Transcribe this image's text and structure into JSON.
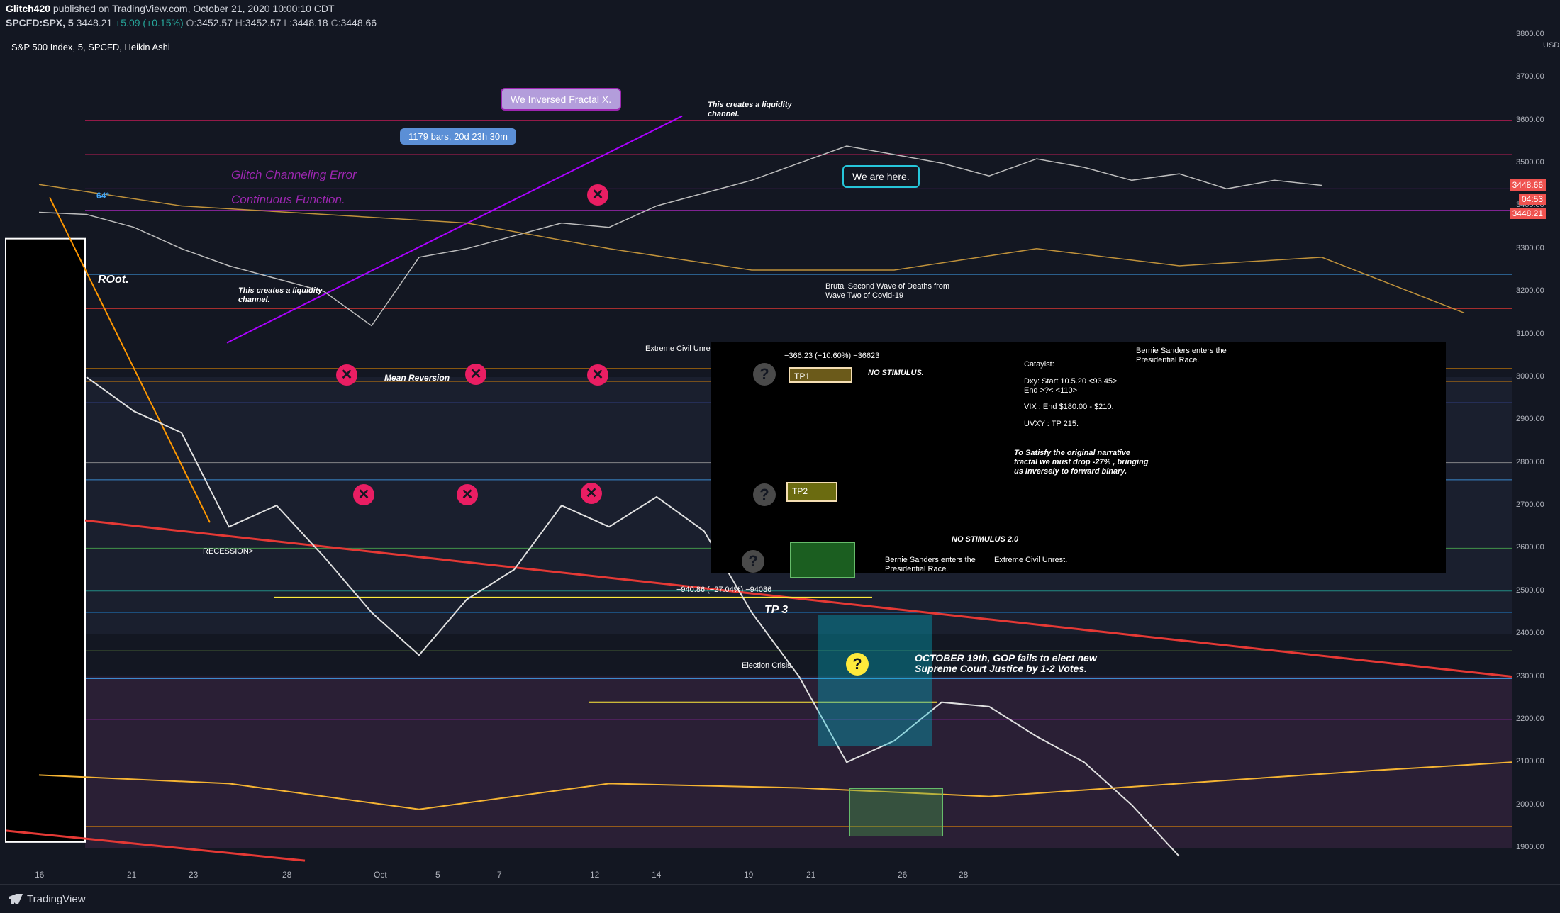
{
  "header": {
    "publisher": "Glitch420",
    "published_text": "published on TradingView.com, October 21, 2020 10:00:10 CDT",
    "symbol": "SPCFD:SPX, 5",
    "last": "3448.21",
    "change": "+5.09 (+0.15%)",
    "o_label": "O:",
    "o_value": "3452.57",
    "h_label": "H:",
    "h_value": "3452.57",
    "l_label": "L:",
    "l_value": "3448.18",
    "c_label": "C:",
    "c_value": "3448.66",
    "legend": "S&P 500 Index, 5, SPCFD, Heikin Ashi"
  },
  "footer": {
    "brand": "TradingView"
  },
  "price_axis": {
    "currency": "USD",
    "ticks": [
      "3800.00",
      "3700.00",
      "3600.00",
      "3500.00",
      "3400.00",
      "3300.00",
      "3200.00",
      "3100.00",
      "3000.00",
      "2900.00",
      "2800.00",
      "2700.00",
      "2600.00",
      "2500.00",
      "2400.00",
      "2300.00",
      "2200.00",
      "2100.00",
      "2000.00",
      "1900.00"
    ],
    "last_price_1": "3448.66",
    "countdown": "04:53",
    "last_price_2": "3448.21"
  },
  "annotations": {
    "inversed_fractal": "We Inversed Fractal X.",
    "bars_range": "1179 bars, 20d 23h 30m",
    "liquidity_top": "This creates a liquidity channel.",
    "glitch_error": "Glitch Channeling Error",
    "continuous": "Continuous Function.",
    "we_are_here": "We are here.",
    "sixty_four": "64°",
    "root": "ROot.",
    "liquidity_left": "This creates a liquidity channel.",
    "second_wave": "Brutal Second Wave of Deaths from Wave Two of Covid-19",
    "civil_unrest_top": "Extreme Civil Unrest.",
    "mean_reversion": "Mean Reversion",
    "measure_1": "−366.23 (−10.60%) −36623",
    "tp1": "TP1",
    "no_stimulus": "NO STIMULUS.",
    "catalyst_title": "Cataylst:",
    "catalyst_dxy": "Dxy: Start 10.5.20 <93.45>",
    "catalyst_end": "End >?< <110>",
    "catalyst_vix": "VIX : End $180.00 - $210.",
    "catalyst_uvxy": "UVXY : TP 215.",
    "bernie_top": "Bernie Sanders enters the Presidential Race.",
    "satisfy": "To Satisfy the original narrative fractal we must drop -27% , bringing us inversely to forward binary.",
    "tp2": "TP2",
    "no_stimulus_2": "NO STIMULUS 2.0",
    "bernie_bottom": "Bernie Sanders enters the Presidential Race.",
    "civil_unrest_bottom": "Extreme Civil Unrest.",
    "recession": "RECESSION>",
    "measure_2": "−940.86 (−27.04%) −94086",
    "tp3": "TP 3",
    "election_crisis": "Election Crisis",
    "october": "OCTOBER 19th, GOP fails to elect new Supreme Court Justice by 1-2 Votes.",
    "x_symbol": "✕",
    "q_symbol": "?"
  },
  "colors": {
    "background": "#131722",
    "purple": "#9c27b0",
    "magenta": "#e91e63",
    "red_line": "#e53935",
    "orange": "#ff9800",
    "yellow": "#ffeb3b",
    "cyan_box": "#00bcd4",
    "green_box": "#4caf50",
    "price_red": "#ef5350"
  },
  "chart_data": {
    "type": "line",
    "title": "S&P 500 Index, 5, SPCFD, Heikin Ashi",
    "xlabel": "",
    "ylabel": "",
    "x_ticks": [
      "16",
      "21",
      "23",
      "28",
      "Oct",
      "5",
      "7",
      "12",
      "14",
      "19",
      "21",
      "26",
      "28"
    ],
    "ylim": [
      1850,
      3820
    ],
    "grid": false,
    "series": [
      {
        "x": [
          16,
          17,
          18,
          19,
          20,
          21,
          22,
          23,
          24,
          25,
          26,
          27,
          28,
          29,
          30,
          31,
          32,
          33,
          34,
          35,
          36,
          37,
          38,
          39,
          40,
          41,
          42,
          43
        ],
        "values": [
          3385,
          3380,
          3350,
          3300,
          3260,
          3230,
          3200,
          3120,
          3280,
          3300,
          3330,
          3360,
          3350,
          3400,
          3430,
          3460,
          3500,
          3540,
          3520,
          3500,
          3470,
          3510,
          3490,
          3460,
          3475,
          3440,
          3460,
          3448
        ]
      },
      {
        "x": [
          17,
          18,
          19,
          20,
          21,
          22,
          23,
          24,
          25,
          26,
          27,
          28,
          29,
          30,
          31,
          32,
          33,
          34,
          35,
          36,
          37,
          38,
          39,
          40
        ],
        "values": [
          3000,
          2920,
          2870,
          2650,
          2700,
          2580,
          2450,
          2350,
          2480,
          2550,
          2700,
          2650,
          2720,
          2640,
          2450,
          2300,
          2100,
          2150,
          2240,
          2230,
          2160,
          2100,
          2000,
          1880
        ]
      },
      {
        "x": [
          16,
          19,
          22,
          25,
          28,
          31,
          34,
          37,
          40,
          43,
          46
        ],
        "values": [
          3450,
          3400,
          3380,
          3360,
          3300,
          3250,
          3250,
          3300,
          3260,
          3280,
          3150
        ]
      },
      {
        "x": [
          16,
          20,
          24,
          28,
          32,
          36,
          40,
          44,
          47
        ],
        "values": [
          2070,
          2050,
          1990,
          2050,
          2040,
          2020,
          2050,
          2080,
          2100
        ]
      }
    ],
    "trendlines": {
      "red_descending": [
        [
          2665,
          2300
        ]
      ],
      "mean_reversion_level": 2990,
      "tp_levels": [
        "TP1",
        "TP2",
        "TP 3"
      ]
    },
    "measurements": [
      "−366.23 (−10.60%) −36623",
      "−940.86 (−27.04%) −94086",
      "1179 bars, 20d 23h 30m"
    ]
  }
}
